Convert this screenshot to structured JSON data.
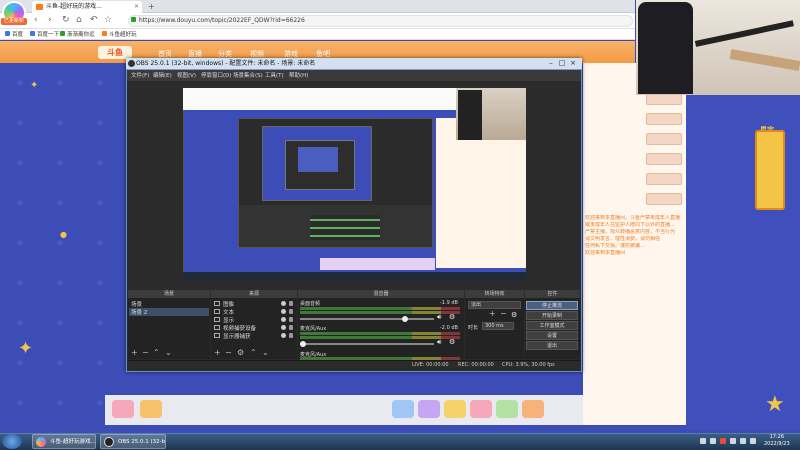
{
  "browser": {
    "logo_label": "已更新新",
    "tab_title": "斗鱼-超好玩的游戏...",
    "tab_close": "×",
    "tab_new": "+",
    "nav": {
      "back": "‹",
      "forward": "›",
      "reload": "↻",
      "home": "⌂",
      "undo": "↶",
      "star": "☆"
    },
    "url": "https://www.douyu.com/topic/2022EF_QDW?rid=66226",
    "bookmarks": [
      "百度",
      "百度一下",
      "渐渐离你远",
      "斗鱼超好玩"
    ]
  },
  "site": {
    "logo": "斗鱼",
    "nav": [
      "首页",
      "直播",
      "分类",
      "视频",
      "游戏",
      "鱼吧"
    ],
    "side_game_label": "星宇",
    "chat_lines": [
      "欢迎来到本直播间，斗鱼严禁未成年人直播",
      "或未成年人在监护人陪同下以外的直播...",
      "严禁主播，观众转播恶意内容，不当行为",
      "请文明发言、理性消费。请勿相信",
      "任何私下交易。谨防被骗...",
      "欢迎来到本直播间"
    ]
  },
  "obs": {
    "title": "OBS 25.0.1 (32-bit, windows) - 配置文件: 未命名 - 场景: 未命名",
    "menus": [
      "文件(F)",
      "编辑(E)",
      "视图(V)",
      "停靠窗口(D)",
      "场景集合(S)",
      "工具(T)",
      "帮助(H)"
    ],
    "docks": {
      "scenes_header": "场景",
      "sources_header": "来源",
      "mixer_header": "混音器",
      "transitions_header": "转场特效",
      "controls_header": "控件"
    },
    "scenes": [
      "场景",
      "场景 2"
    ],
    "sources": [
      "图像",
      "文本",
      "显示",
      "视频捕获设备",
      "显示器捕获"
    ],
    "mixer": [
      {
        "name": "桌面音频",
        "db": "-1.9 dB"
      },
      {
        "name": "麦克风/Aux",
        "db": "-2.0 dB"
      }
    ],
    "mixer_extra": "麦克风/Aux",
    "transition": {
      "type": "淡出",
      "duration_label": "时长",
      "duration_value": "300 ms"
    },
    "controls": [
      "停止推流",
      "开始录制",
      "工作室模式",
      "设置",
      "退出"
    ],
    "status": {
      "live": "LIVE: 00:00:00",
      "rec": "REC: 00:00:00",
      "cpu": "CPU: 3.9%, 30.00 fps"
    }
  },
  "taskbar": {
    "items": [
      "斗鱼-超好玩游戏...",
      "OBS 25.0.1 (32-bit..."
    ],
    "time": "17:26",
    "date": "2022/9/23"
  }
}
